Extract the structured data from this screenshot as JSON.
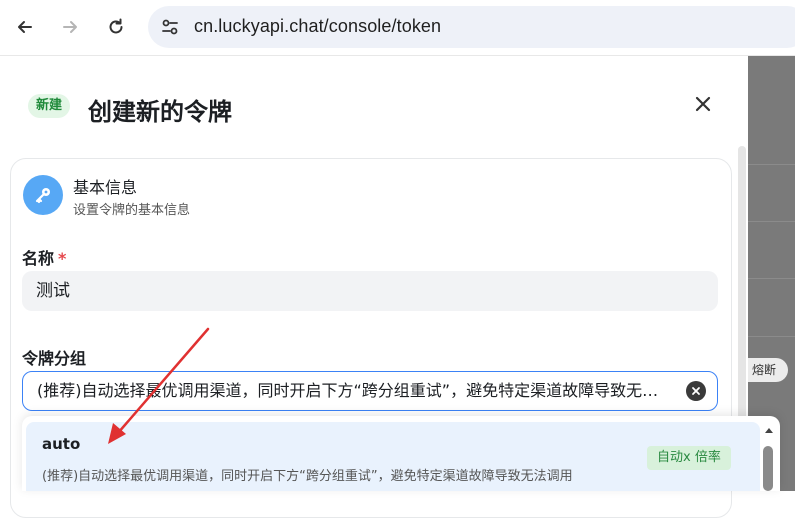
{
  "browser": {
    "url": "cn.luckyapi.chat/console/token",
    "back_icon": "arrow-left-icon",
    "forward_icon": "arrow-right-icon",
    "reload_icon": "reload-icon",
    "site_info_icon": "tune-icon"
  },
  "background": {
    "chip_label": "熔断"
  },
  "drawer": {
    "badge": "新建",
    "title": "创建新的令牌",
    "close_icon": "close-icon",
    "section": {
      "icon": "key-icon",
      "title": "基本信息",
      "subtitle": "设置令牌的基本信息"
    },
    "name_field": {
      "label": "名称",
      "required_mark": "*",
      "value": "测试"
    },
    "group_field": {
      "label": "令牌分组",
      "value": "(推荐)自动选择最优调用渠道，同时开启下方“跨分组重试”，避免特定渠道故障导致无法调用"
    },
    "dropdown": {
      "options": [
        {
          "name": "auto",
          "description": "(推荐)自动选择最优调用渠道，同时开启下方“跨分组重试”，避免特定渠道故障导致无法调用",
          "badge": "自动x 倍率"
        }
      ]
    }
  },
  "colors": {
    "accent": "#3b82f6",
    "badge_green_bg": "#e3f6e6",
    "badge_green_text": "#1f8a3a",
    "option_highlight": "#e9f2fd",
    "annotation_arrow": "#e03131"
  }
}
